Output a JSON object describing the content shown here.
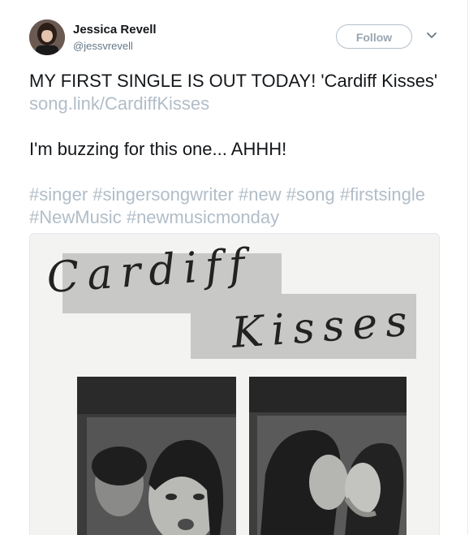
{
  "user": {
    "display_name": "Jessica Revell",
    "handle": "@jessvrevell"
  },
  "actions": {
    "follow_label": "Follow"
  },
  "tweet": {
    "line1_text": "MY FIRST SINGLE IS OUT TODAY! 'Cardiff Kisses' ",
    "link_text": "song.link/CardiffKisses",
    "line2_text": "I'm buzzing for this one... AHHH!",
    "hashtags": [
      "#singer",
      "#singersongwriter",
      "#new",
      "#song",
      "#firstsingle",
      "#NewMusic",
      "#newmusicmonday"
    ]
  },
  "media": {
    "artwork_title_line1": "Cardiff",
    "artwork_title_line2": "Kisses"
  },
  "colors": {
    "text": "#14171a",
    "muted": "#657786",
    "link": "#b1bdc8",
    "follow_border": "#b3bfc9"
  },
  "icons": {
    "menu": "chevron-down-icon"
  }
}
